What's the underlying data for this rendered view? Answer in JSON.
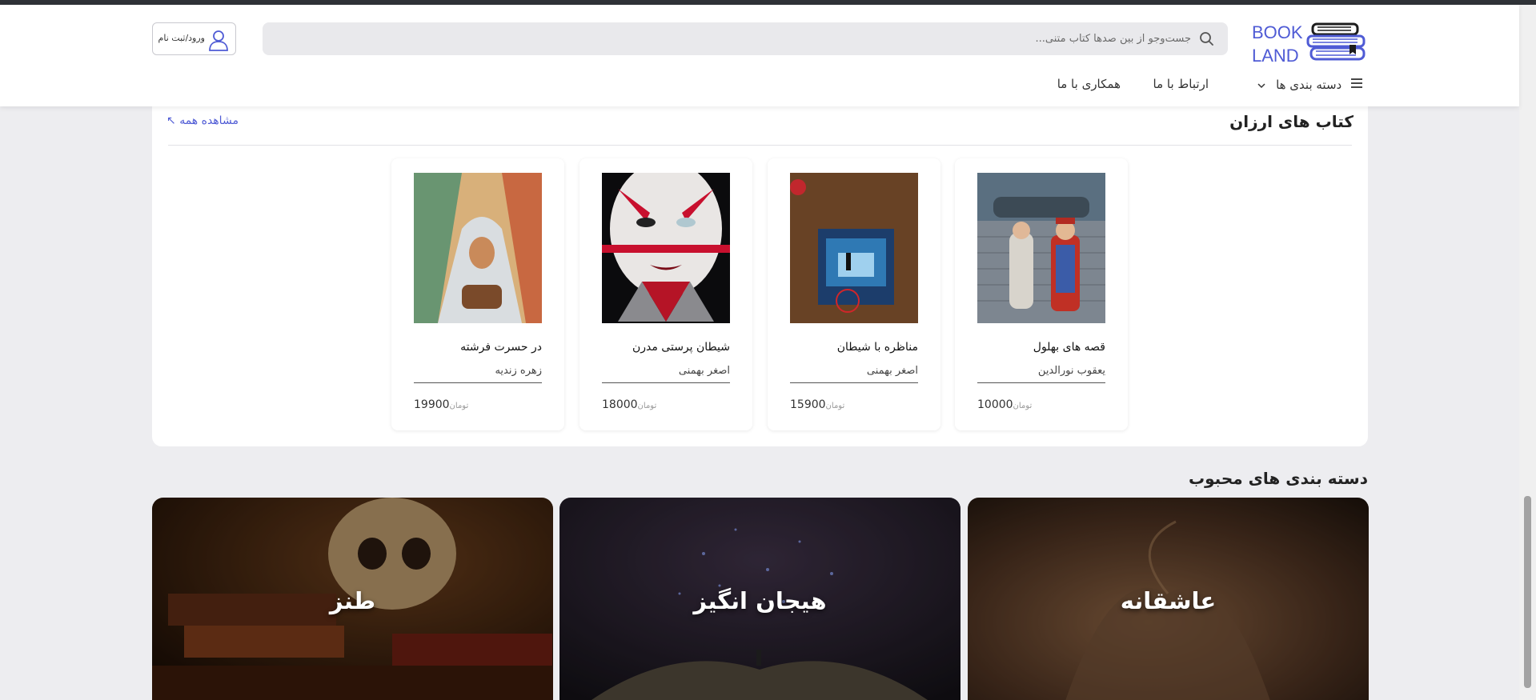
{
  "header": {
    "logo": {
      "line1": "BOOK",
      "line2": "LAND"
    },
    "search": {
      "placeholder": "جست‌وجو از بین صدها کتاب متنی..."
    },
    "login_label": "ورود/ثبت نام",
    "nav": {
      "categories": "دسته بندی ها",
      "contact": "ارتباط با ما",
      "cooperation": "همکاری با ما"
    }
  },
  "cheap_books": {
    "title": "کتاب های ارزان",
    "view_all": "مشاهده همه",
    "currency": "تومان",
    "items": [
      {
        "title": "قصه های بهلول",
        "author": "یعقوب نورالدین",
        "price": "10000"
      },
      {
        "title": "مناظره با شیطان",
        "author": "اصغر بهمنی",
        "price": "15900"
      },
      {
        "title": "شیطان پرستی مدرن",
        "author": "اصغر بهمنی",
        "price": "18000"
      },
      {
        "title": "در حسرت فرشته",
        "author": "زهره زندیه",
        "price": "19900"
      }
    ]
  },
  "popular_categories": {
    "title": "دسته بندی های محبوب",
    "items": [
      {
        "label": "عاشقانه"
      },
      {
        "label": "هیجان انگیز"
      },
      {
        "label": "طنز"
      }
    ]
  },
  "colors": {
    "accent": "#4f5bd5",
    "page_bg": "#ededf0"
  }
}
